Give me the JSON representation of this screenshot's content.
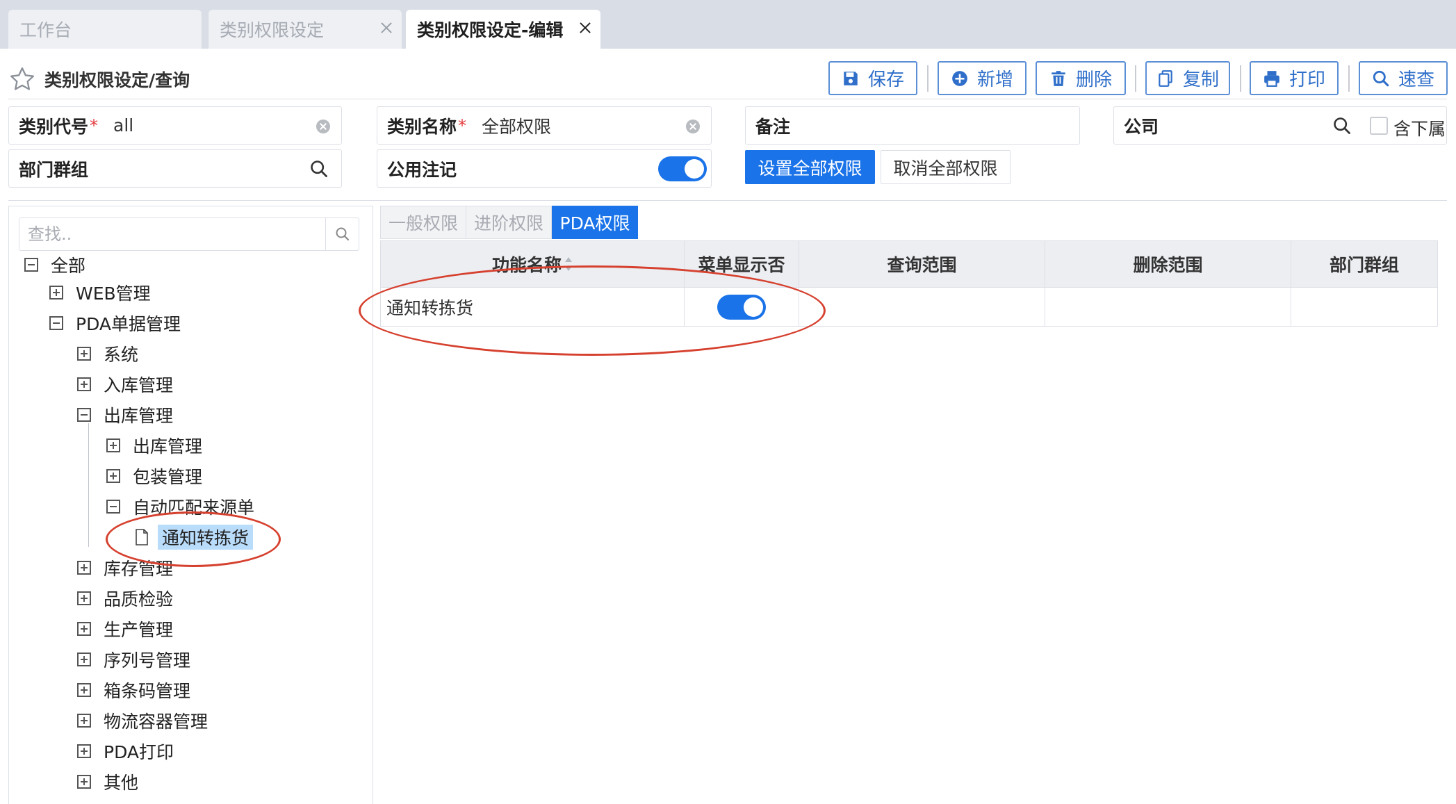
{
  "tabs": [
    {
      "label": "工作台",
      "active": false,
      "closable": false
    },
    {
      "label": "类别权限设定",
      "active": false,
      "closable": true
    },
    {
      "label": "类别权限设定-编辑",
      "active": true,
      "closable": true
    }
  ],
  "page_title": "类别权限设定/查询",
  "toolbar": {
    "save": "保存",
    "add": "新增",
    "delete": "删除",
    "copy": "复制",
    "print": "打印",
    "quick_search": "速查"
  },
  "form": {
    "category_code_label": "类别代号",
    "category_code_value": "all",
    "category_name_label": "类别名称",
    "category_name_value": "全部权限",
    "required_mark": "*",
    "remark_label": "备注",
    "company_label": "公司",
    "include_sub_label": "含下属",
    "include_sub_checked": false,
    "dept_group_label": "部门群组",
    "public_label": "公用注记",
    "public_on": true,
    "set_all_button": "设置全部权限",
    "cancel_all_button": "取消全部权限"
  },
  "tree": {
    "search_placeholder": "查找..",
    "nodes": {
      "all": "全部",
      "web": "WEB管理",
      "pda": "PDA单据管理",
      "system": "系统",
      "inbound": "入库管理",
      "outbound": "出库管理",
      "outbound_sub": "出库管理",
      "packing": "包装管理",
      "auto_match": "自动匹配来源单",
      "notify_pick": "通知转拣货",
      "inventory": "库存管理",
      "quality": "品质检验",
      "production": "生产管理",
      "serial": "序列号管理",
      "box_barcode": "箱条码管理",
      "logistics": "物流容器管理",
      "pda_print": "PDA打印",
      "other": "其他"
    }
  },
  "perm_tabs": [
    "一般权限",
    "进阶权限",
    "PDA权限"
  ],
  "perm_tab_active": 2,
  "grid": {
    "headers": [
      "功能名称",
      "菜单显示否",
      "查询范围",
      "删除范围",
      "部门群组"
    ],
    "rows": [
      {
        "name": "通知转拣货",
        "menu_show": true,
        "query_scope": "",
        "delete_scope": "",
        "dept_group": ""
      }
    ]
  },
  "colors": {
    "primary": "#1a73e8",
    "toolbar_text": "#2f6fca",
    "annotation": "#d6402e",
    "selected_bg": "#b9dcfb"
  }
}
